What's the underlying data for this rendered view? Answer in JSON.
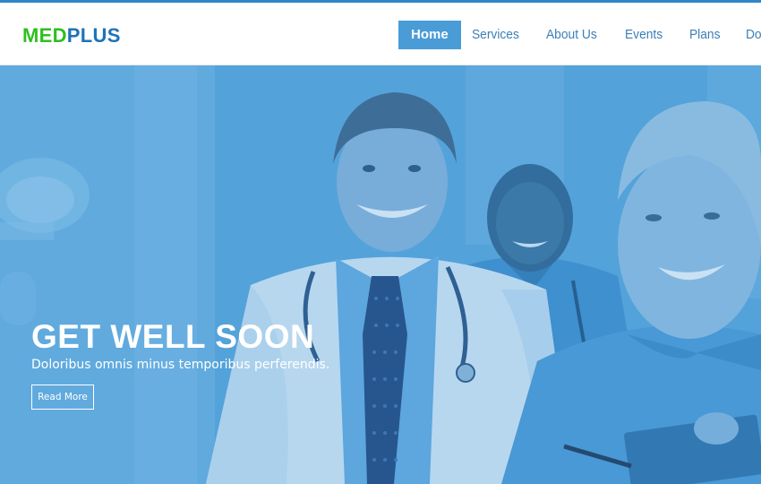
{
  "brand": {
    "part1": "MED",
    "part2": "PLUS"
  },
  "nav": {
    "items": [
      {
        "label": "Home",
        "active": true
      },
      {
        "label": "Services"
      },
      {
        "label": "About Us"
      },
      {
        "label": "Events"
      },
      {
        "label": "Plans"
      },
      {
        "label": "Doctors"
      }
    ]
  },
  "hero": {
    "title": "GET WELL SOON",
    "subtitle": "Doloribus omnis minus temporibus perferendis.",
    "button_label": "Read More"
  },
  "colors": {
    "accent": "#4a9cd6",
    "brand_green": "#2fbf1f",
    "brand_blue": "#1e73b8",
    "overlay_blue": "#4b9ad5"
  }
}
